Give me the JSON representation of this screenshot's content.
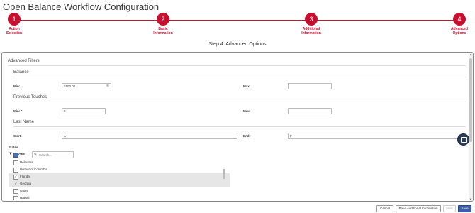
{
  "page_title": "Open Balance Workflow Configuration",
  "steps": [
    {
      "number": "1",
      "label_line1": "Action",
      "label_line2": "Selection"
    },
    {
      "number": "2",
      "label_line1": "Basic",
      "label_line2": "Information"
    },
    {
      "number": "3",
      "label_line1": "Additional",
      "label_line2": "Information"
    },
    {
      "number": "4",
      "label_line1": "Advanced",
      "label_line2": "Options"
    }
  ],
  "step_heading": "Step 4: Advanced Options",
  "advanced_filters": {
    "title": "Advanced Filters",
    "balance": {
      "title": "Balance",
      "min_label": "Min:",
      "min_value": "$100.00",
      "max_label": "Max:",
      "max_value": ""
    },
    "previous_touches": {
      "title": "Previous Touches",
      "min_label": "Min: *",
      "min_value": "0",
      "max_label": "Max:",
      "max_value": ""
    },
    "last_name": {
      "title": "Last Name",
      "start_label": "Start:",
      "start_value": "A",
      "end_label": "End:",
      "end_value": "F"
    },
    "states": {
      "title": "States",
      "toggle_label": "OFF",
      "search_placeholder": "Search...",
      "items": [
        {
          "name": "Delaware",
          "checked": false,
          "selected": false
        },
        {
          "name": "District of Columbia",
          "checked": false,
          "selected": false
        },
        {
          "name": "Florida",
          "checked": true,
          "selected": true
        },
        {
          "name": "Georgia",
          "checked": true,
          "selected": true
        },
        {
          "name": "Guam",
          "checked": false,
          "selected": false
        },
        {
          "name": "Hawaii",
          "checked": false,
          "selected": false
        }
      ]
    }
  },
  "footer": {
    "cancel": "Cancel",
    "prev": "Prev: Additional Information",
    "next": "Next",
    "save": "Save"
  },
  "colors": {
    "accent": "#c8102e",
    "primary_button": "#3b5ca8"
  }
}
